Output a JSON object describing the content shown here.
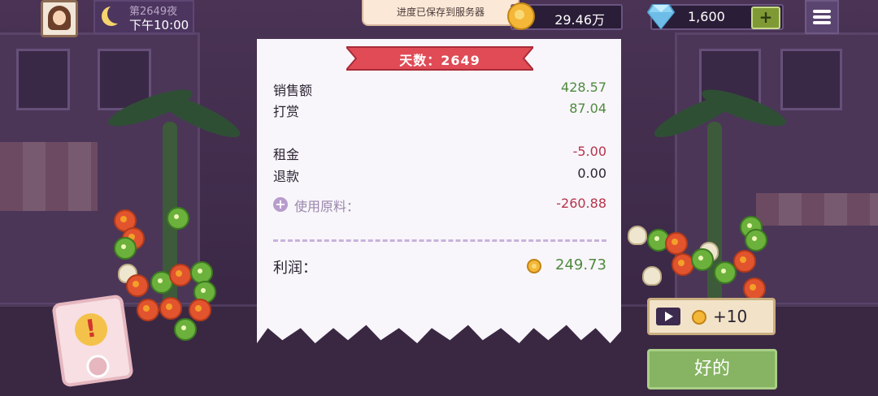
{
  "hud": {
    "day_label": "第2649夜",
    "time_label": "下午10:00",
    "save_toast": "进度已保存到服务器",
    "coins": "29.46万",
    "gems": "1,600",
    "gem_plus": "+"
  },
  "receipt": {
    "day_title": "天数：2649",
    "rows": [
      {
        "label": "销售额",
        "value": "428.57"
      },
      {
        "label": "打赏",
        "value": "87.04"
      },
      {
        "label": "租金",
        "value": "-5.00"
      },
      {
        "label": "退款",
        "value": "0.00"
      }
    ],
    "ingredients": {
      "expand": "+",
      "label": "使用原料：",
      "value": "-260.88"
    },
    "profit": {
      "label": "利润：",
      "value": "249.73"
    }
  },
  "actions": {
    "ad_reward": "+10",
    "ok": "好的"
  },
  "phone": {
    "alert": "!"
  },
  "colors": {
    "positive": "#4f8a3f",
    "negative": "#b6344c",
    "ok_button": "#86b462",
    "ribbon": "#e04b55"
  }
}
